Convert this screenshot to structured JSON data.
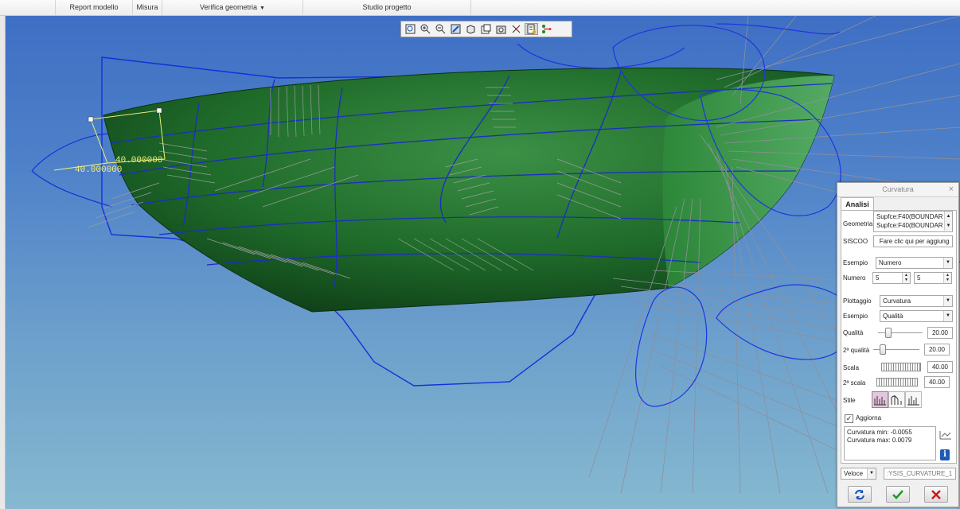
{
  "menubar": {
    "items": [
      {
        "label": "Report modello"
      },
      {
        "label": "Misura"
      },
      {
        "label": "Verifica geometria",
        "has_dropdown": true
      },
      {
        "label": "Studio progetto"
      }
    ]
  },
  "view_toolbar": {
    "buttons": [
      {
        "icon": "refit-icon"
      },
      {
        "icon": "zoom-in-icon"
      },
      {
        "icon": "zoom-out-icon"
      },
      {
        "icon": "repaint-icon"
      },
      {
        "icon": "display-style-icon"
      },
      {
        "icon": "saved-views-icon"
      },
      {
        "icon": "view-manager-icon"
      },
      {
        "icon": "datum-display-icon"
      },
      {
        "icon": "annotation-display-icon",
        "active": true
      },
      {
        "icon": "spin-center-icon"
      }
    ]
  },
  "dimensions": {
    "upper": "40.000000",
    "lower": "40.000000"
  },
  "colors": {
    "surface_green": "#1f6b2a",
    "curve_blue": "#1530d8",
    "dimension_yellow": "#f2ee7a",
    "background_top": "#3f6fc4",
    "background_bottom": "#86b9d0"
  },
  "dialog": {
    "title": "Curvatura",
    "tab": "Analisi",
    "geometria_label": "Geometria",
    "geometria_items": [
      "Supfce:F40(BOUNDAR",
      "Supfce:F40(BOUNDAR"
    ],
    "siscoo_label": "SISCOO",
    "siscoo_value": "Fare clic qui per aggiung",
    "esempio_label": "Esempio",
    "esempio_value": "Numero",
    "numero_label": "Numero",
    "numero_u": "5",
    "numero_v": "5",
    "plottaggio_label": "Plottaggio",
    "plottaggio_value": "Curvatura",
    "esempio2_label": "Esempio",
    "esempio2_value": "Qualità",
    "qualita_label": "Qualità",
    "qualita_value": "20.00",
    "qualita2_label": "2ª qualità",
    "qualita2_value": "20.00",
    "scala_label": "Scala",
    "scala_value": "40.00",
    "scala2_label": "2ª scala",
    "scala2_value": "40.00",
    "stile_label": "Stile",
    "aggiorna_label": "Aggiorna",
    "aggiorna_checked": true,
    "result_min": "Curvatura min: -0.0055",
    "result_max": "Curvatura max: 0.0079",
    "mode_value": "Veloce",
    "analysis_name": ":YSIS_CURVATURE_1"
  }
}
